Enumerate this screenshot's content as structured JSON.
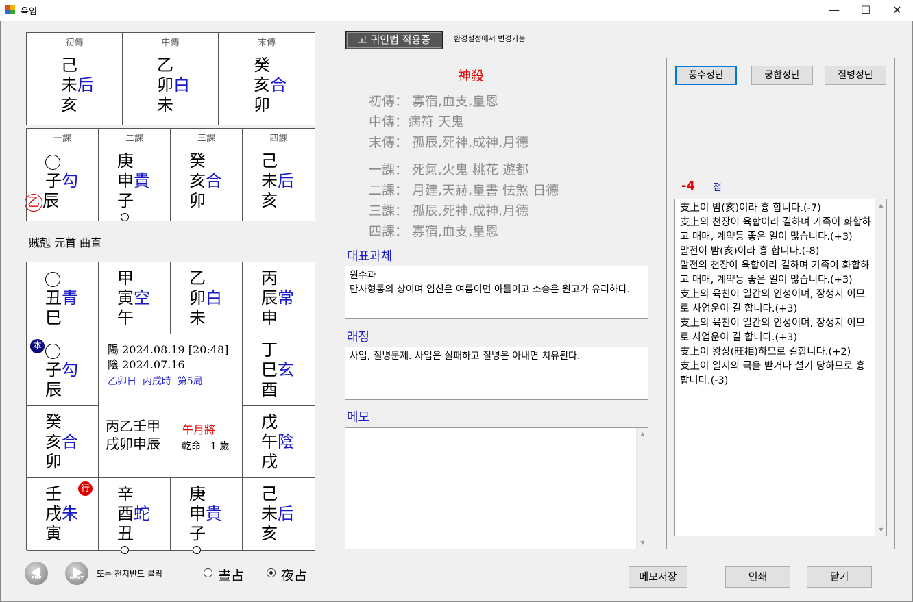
{
  "window": {
    "title": "육임",
    "minimize": "—",
    "maximize": "☐",
    "close": "✕"
  },
  "sanjeon": {
    "headers": [
      "初傳",
      "中傳",
      "末傳"
    ],
    "cols": [
      {
        "top": "己",
        "mid": "未",
        "god": "后",
        "bot": "亥"
      },
      {
        "top": "乙",
        "mid": "卯",
        "god": "白",
        "bot": "未"
      },
      {
        "top": "癸",
        "mid": "亥",
        "god": "合",
        "bot": "卯"
      }
    ]
  },
  "sagwa": {
    "headers": [
      "一課",
      "二課",
      "三課",
      "四課"
    ],
    "cols": [
      {
        "top": "",
        "mid": "子",
        "god": "勾",
        "bot": "辰",
        "bot_prefix": "乙"
      },
      {
        "top": "庚",
        "mid": "申",
        "god": "貴",
        "bot": "子"
      },
      {
        "top": "癸",
        "mid": "亥",
        "god": "合",
        "bot": "卯"
      },
      {
        "top": "己",
        "mid": "未",
        "god": "后",
        "bot": "亥"
      }
    ]
  },
  "subinfo": "賊剋 元首 曲直",
  "chart": {
    "top_row": [
      {
        "top": "",
        "mid": "丑",
        "god": "青",
        "bot": "巳"
      },
      {
        "top": "甲",
        "mid": "寅",
        "god": "空",
        "bot": "午"
      },
      {
        "top": "乙",
        "mid": "卯",
        "god": "白",
        "bot": "未"
      },
      {
        "top": "丙",
        "mid": "辰",
        "god": "常",
        "bot": "申"
      }
    ],
    "left_col": [
      {
        "top": "",
        "mid": "子",
        "god": "勾",
        "bot": "辰",
        "badge": "本"
      },
      {
        "top": "癸",
        "mid": "亥",
        "god": "合",
        "bot": "卯"
      }
    ],
    "right_col": [
      {
        "top": "丁",
        "mid": "巳",
        "god": "玄",
        "bot": "酉"
      },
      {
        "top": "戊",
        "mid": "午",
        "god": "陰",
        "bot": "戌"
      }
    ],
    "bottom_row": [
      {
        "top": "壬",
        "mid": "戌",
        "god": "朱",
        "bot": "寅",
        "badge": "行"
      },
      {
        "top": "辛",
        "mid": "酉",
        "god": "蛇",
        "bot": "丑"
      },
      {
        "top": "庚",
        "mid": "申",
        "god": "貴",
        "bot": "子"
      },
      {
        "top": "己",
        "mid": "未",
        "god": "后",
        "bot": "亥"
      }
    ],
    "center": {
      "solar": "陽 2024.08.19 [20:48]",
      "lunar": "陰 2024.07.16",
      "day": "乙卯日",
      "hour": "丙戌時",
      "guk": "第5局",
      "saju_top": "丙乙壬甲",
      "saju_bot": "戌卯申辰",
      "wolJang": "午月將",
      "age": "乾命　1 歲"
    }
  },
  "guin": {
    "button": "고 귀인법 적용중",
    "note": "환경설정에서 변경가능"
  },
  "shinsal": {
    "title": "神殺",
    "lines": [
      "初傳：  寡宿,血支,皇恩",
      "中傳：病符 天鬼",
      "末傳：  孤辰,死神,成神,月德",
      "一課：  死氣,火鬼 桃花 遊都",
      "二課：  月建,天赫,皇書 怯煞 日德",
      "三課：  孤辰,死神,成神,月德",
      "四課：  寡宿,血支,皇恩"
    ]
  },
  "daepyo": {
    "title": "대표과체",
    "lines": [
      "원수과",
      "만사형통의 상이며 임신은 여름이면 아들이고 소송은 원고가 유리하다."
    ]
  },
  "raejeong": {
    "title": "래정",
    "text": "사업, 질병문제. 사업은 실패하고 질병은 아내면 치유된다."
  },
  "memo": {
    "title": "메모",
    "value": ""
  },
  "right": {
    "buttons": [
      "풍수정단",
      "궁합정단",
      "질병정단"
    ],
    "score": "-4",
    "score_unit": "점",
    "lines": [
      "支上이 밤(亥)이라 흉 합니다.(-7)",
      "支上의 천장이 육합이라 길하며 가족이 화합하고 매매, 계약등 좋은 일이 많습니다.(+3)",
      "말전이 밤(亥)이라 흉 합니다.(-8)",
      "말전의 천장이 육합이라 길하며 가족이 화합하고 매매, 계약등 좋은 일이 많습니다.(+3)",
      "支上의 육친이 일간의 인성이며, 장생지 이므로 사업운이 길 합니다.(+3)",
      "支上의 육친이 일간의 인성이며, 장생지 이므로 사업운이 길 합니다.(+3)",
      "支上이 왕상(旺相)하므로 길합니다.(+2)",
      "支上이 일지의 극을 받거나 설기 당하므로 흉합니다.(-3)"
    ]
  },
  "bottom": {
    "pre": "PRE",
    "next": "NEXT",
    "note": "또는 천지반도 클릭",
    "day_label": "晝占",
    "night_label": "夜占",
    "selected": "night",
    "memo_save": "메모저장",
    "print": "인쇄",
    "close": "닫기"
  },
  "colors": {
    "god": "#1a1ac8",
    "accent": "#e00000",
    "badge_bg": "#0b0b7a",
    "badge_red": "#e00000"
  }
}
